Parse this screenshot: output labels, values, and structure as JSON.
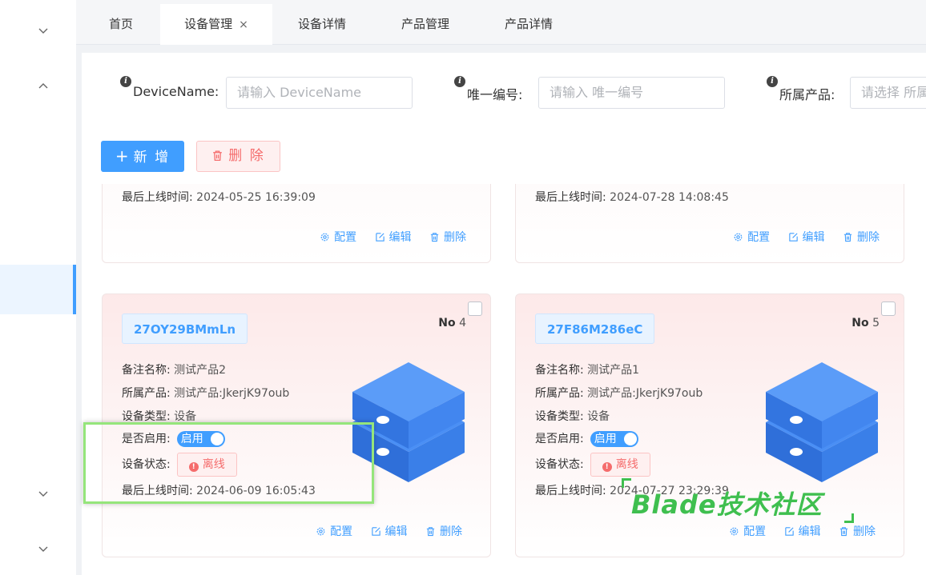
{
  "tabs": [
    {
      "label": "首页"
    },
    {
      "label": "设备管理",
      "close": "×"
    },
    {
      "label": "设备详情"
    },
    {
      "label": "产品管理"
    },
    {
      "label": "产品详情"
    }
  ],
  "filters": {
    "device_name": {
      "label": "DeviceName:",
      "placeholder": "请输入 DeviceName"
    },
    "unique_no": {
      "label": "唯一编号:",
      "placeholder": "请输入 唯一编号"
    },
    "product": {
      "label": "所属产品:",
      "placeholder": "请选择 所属产品"
    }
  },
  "toolbar": {
    "add_label": "新 增",
    "delete_label": "删 除"
  },
  "labels": {
    "remark": "备注名称:",
    "product": "所属产品:",
    "type": "设备类型:",
    "enabled": "是否启用:",
    "status": "设备状态:",
    "last_online": "最后上线时间:",
    "no": "No",
    "switch_on": "启用",
    "offline": "离线"
  },
  "actions": {
    "config": "配置",
    "edit": "编辑",
    "delete": "删除"
  },
  "cards_top": [
    {
      "last_online": "2024-05-25 16:39:09"
    },
    {
      "last_online": "2024-07-28 14:08:45"
    }
  ],
  "cards": [
    {
      "code": "27OY29BMmLn",
      "no": "4",
      "remark": "测试产品2",
      "product": "测试产品:JkerjK97oub",
      "type": "设备",
      "last_online": "2024-06-09 16:05:43"
    },
    {
      "code": "27F86M286eC",
      "no": "5",
      "remark": "测试产品1",
      "product": "测试产品:JkerjK97oub",
      "type": "设备",
      "last_online": "2024-07-27 23:29:39"
    }
  ],
  "watermark": "Blade技术社区",
  "colors": {
    "primary": "#409eff",
    "danger": "#f56c6c",
    "highlight": "#95e57b",
    "watermark": "#3fbf4f"
  }
}
